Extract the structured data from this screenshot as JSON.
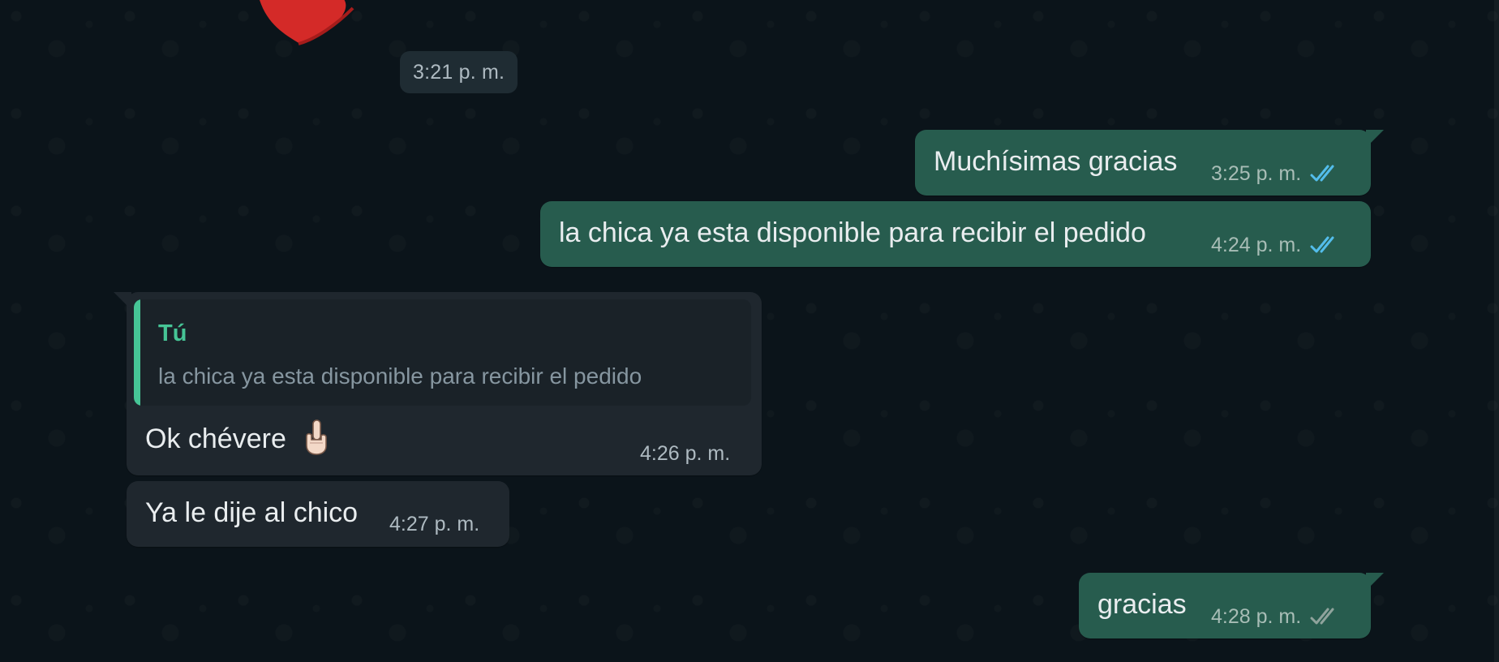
{
  "date_separator": {
    "time": "3:21 p. m."
  },
  "messages": [
    {
      "direction": "outgoing",
      "text": "Muchísimas gracias",
      "time": "3:25 p. m.",
      "status": "read",
      "status_icon": "double-check-icon",
      "status_color": "#53bdeb"
    },
    {
      "direction": "outgoing",
      "text": "la chica ya esta disponible para recibir el pedido",
      "time": "4:24 p. m.",
      "status": "read",
      "status_icon": "double-check-icon",
      "status_color": "#53bdeb"
    },
    {
      "direction": "incoming",
      "quote": {
        "author": "Tú",
        "text": "la chica ya esta disponible para recibir el pedido"
      },
      "text": "Ok chévere",
      "emoji": "☝️",
      "time": "4:26 p. m."
    },
    {
      "direction": "incoming",
      "text": "Ya le dije al chico",
      "time": "4:27 p. m."
    },
    {
      "direction": "outgoing",
      "text": "gracias",
      "time": "4:28 p. m.",
      "status": "delivered",
      "status_icon": "double-check-icon",
      "status_color": "#8fa39c"
    }
  ],
  "colors": {
    "chat_background": "#0b141a",
    "outgoing_bubble": "#275c4e",
    "incoming_bubble": "#1f272e",
    "quote_accent": "#46c596",
    "read_tick": "#53bdeb"
  }
}
